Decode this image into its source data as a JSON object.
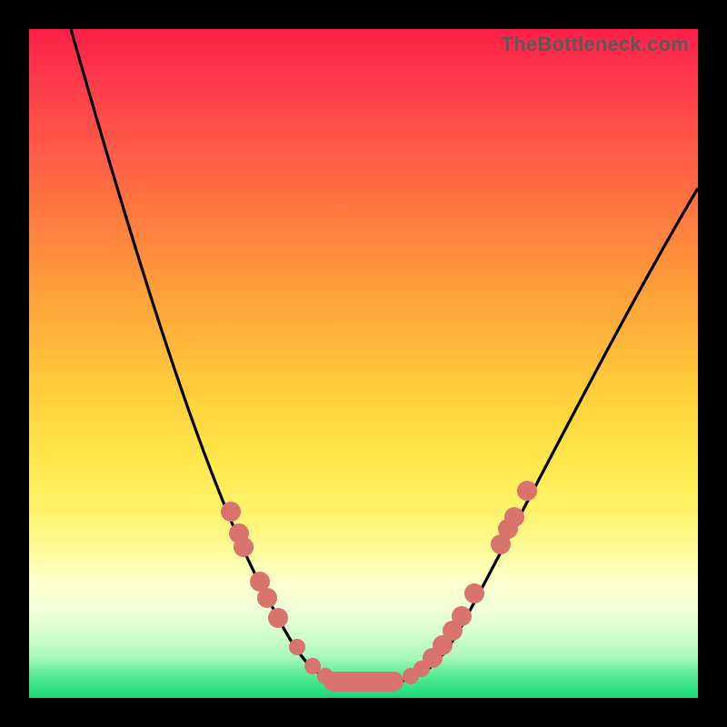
{
  "watermark": "TheBottleneck.com",
  "chart_data": {
    "type": "line",
    "title": "",
    "xlabel": "",
    "ylabel": "",
    "x_range": [
      0,
      100
    ],
    "y_range": [
      0,
      100
    ],
    "y_meaning": "bottleneck percentage (0 = green/optimal at bottom, 100 = red/severe at top)",
    "x_meaning": "relative component performance index (left = low, right = high)",
    "grid": false,
    "legend": false,
    "series": [
      {
        "name": "bottleneck-curve",
        "style": "smooth-line",
        "color": "#000000",
        "points_xy": [
          [
            6,
            100
          ],
          [
            16,
            65
          ],
          [
            27,
            30
          ],
          [
            37,
            13
          ],
          [
            44,
            2.5
          ],
          [
            48,
            2.5
          ],
          [
            55,
            2.5
          ],
          [
            66,
            13
          ],
          [
            76,
            32
          ],
          [
            88,
            55
          ],
          [
            100,
            76
          ]
        ]
      },
      {
        "name": "left-branch-markers",
        "style": "scatter",
        "color": "#d8736e",
        "points_xy": [
          [
            30.2,
            27.9
          ],
          [
            31.4,
            24.6
          ],
          [
            32.1,
            22.6
          ],
          [
            34.5,
            17.4
          ],
          [
            35.6,
            15.0
          ],
          [
            37.2,
            12.0
          ],
          [
            40.1,
            7.6
          ],
          [
            42.4,
            4.8
          ],
          [
            44.3,
            3.3
          ]
        ]
      },
      {
        "name": "minimum-plateau",
        "style": "bar-segment",
        "color": "#d8736e",
        "y": 2.4,
        "x_start": 44.0,
        "x_end": 56.0
      },
      {
        "name": "right-branch-markers",
        "style": "scatter",
        "color": "#d8736e",
        "points_xy": [
          [
            57.1,
            3.3
          ],
          [
            58.7,
            4.3
          ],
          [
            60.3,
            6.0
          ],
          [
            61.8,
            7.9
          ],
          [
            63.3,
            10.1
          ],
          [
            64.7,
            12.2
          ],
          [
            66.6,
            15.6
          ],
          [
            70.5,
            23.0
          ],
          [
            71.6,
            25.3
          ],
          [
            72.6,
            27.0
          ],
          [
            74.5,
            31.0
          ]
        ]
      }
    ],
    "background_gradient": {
      "direction": "top-to-bottom",
      "stops": [
        {
          "pos": 0.0,
          "color": "#ff1f4a"
        },
        {
          "pos": 0.55,
          "color": "#ffd03a"
        },
        {
          "pos": 0.82,
          "color": "#feffc6"
        },
        {
          "pos": 1.0,
          "color": "#1bd87a"
        }
      ]
    }
  }
}
